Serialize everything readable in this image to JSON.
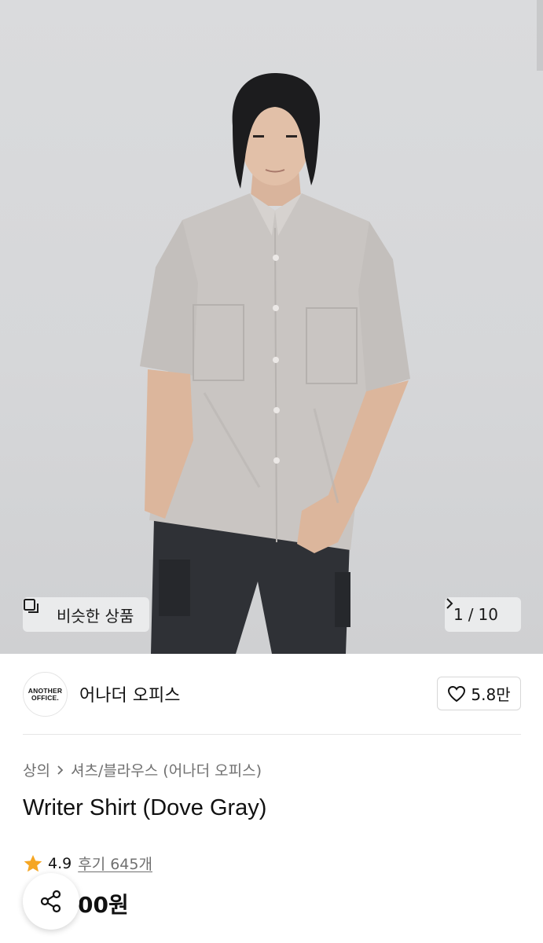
{
  "gallery": {
    "similar_label": "비슷한 상품",
    "similar_icon": "stacked-squares-icon",
    "pager": {
      "current": "1",
      "separator": "/",
      "total": "10"
    },
    "next_icon": "chevron-right-icon"
  },
  "brand": {
    "logo_lines": [
      "ANOTHER",
      "OFFICE."
    ],
    "name": "어나더 오피스",
    "like_count": "5.8만",
    "like_icon": "heart-outline-icon"
  },
  "product": {
    "breadcrumb": [
      "상의",
      "셔츠/블라우스 (어나더 오피스)"
    ],
    "title": "Writer Shirt (Dove Gray)",
    "rating": "4.9",
    "review_label": "후기 645개",
    "price_partial": "00원",
    "star_color": "#f5a623",
    "share_icon": "share-icon"
  }
}
